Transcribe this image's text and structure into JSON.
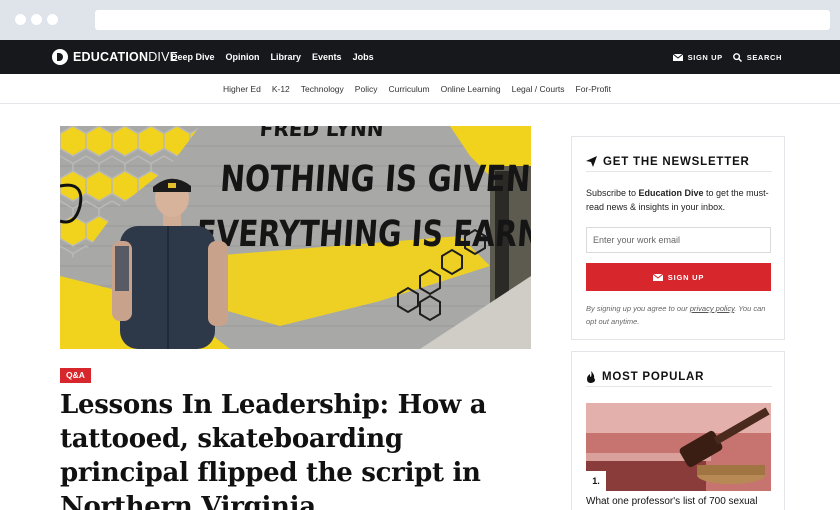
{
  "brand": {
    "logo_bold": "EDUCATION",
    "logo_light": "DIVE"
  },
  "topnav": {
    "links": [
      "Deep Dive",
      "Opinion",
      "Library",
      "Events",
      "Jobs"
    ],
    "signup_label": "SIGN UP",
    "search_label": "SEARCH"
  },
  "subnav": {
    "links": [
      "Higher Ed",
      "K-12",
      "Technology",
      "Policy",
      "Curriculum",
      "Online Learning",
      "Legal / Courts",
      "For-Profit"
    ]
  },
  "article": {
    "badge": "Q&A",
    "headline": "Lessons In Leadership: How a tattooed, skateboarding principal flipped the script in Northern Virginia",
    "hero_wall_text": [
      "NOTHING IS GIVEN.",
      "EVERYTHING IS EARNED."
    ],
    "hero_wall_top_text": "FRED LYNN"
  },
  "newsletter": {
    "title": "GET THE NEWSLETTER",
    "desc_prefix": "Subscribe to ",
    "desc_brand": "Education Dive",
    "desc_suffix": " to get the must-read news & insights in your inbox.",
    "email_placeholder": "Enter your work email",
    "signup_label": "SIGN UP",
    "fine_print_prefix": "By signing up you agree to our ",
    "privacy_link": "privacy policy",
    "fine_print_suffix": ". You can opt out anytime."
  },
  "popular": {
    "title": "MOST POPULAR",
    "items": [
      {
        "rank": "1.",
        "title": "What one professor's list of 700 sexual"
      }
    ]
  },
  "colors": {
    "brand_red": "#d7262c",
    "nav_dark": "#16181c",
    "wall_yellow": "#f1d21c"
  }
}
